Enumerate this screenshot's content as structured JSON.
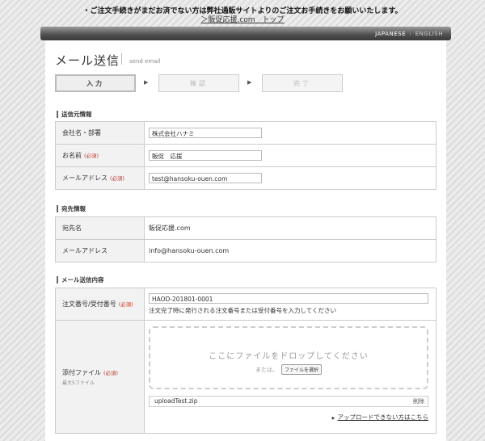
{
  "notice": {
    "text": "・ご注文手続きがまだお済でない方は弊社通販サイトよりのご注文お手続きをお願いいたします。",
    "top_link": "＞販促応援.com　トップ"
  },
  "lang": {
    "japanese": "JAPANESE",
    "separator": "|",
    "english": "ENGLISH"
  },
  "page": {
    "title": "メール送信",
    "subtitle": "send email"
  },
  "steps": [
    {
      "label": "入力"
    },
    {
      "label": "確認"
    },
    {
      "label": "完了"
    }
  ],
  "sender": {
    "title": "送信元情報",
    "rows": [
      {
        "label": "会社名・部署",
        "required": "",
        "value": "株式会社ハナミ"
      },
      {
        "label": "お名前",
        "required": "(必須)",
        "value": "販促　応援"
      },
      {
        "label": "メールアドレス",
        "required": "(必須)",
        "value": "test@hansoku-ouen.com"
      }
    ]
  },
  "recipient": {
    "title": "宛先情報",
    "rows": [
      {
        "label": "宛先名",
        "value": "販促応援.com"
      },
      {
        "label": "メールアドレス",
        "value": "info@hansoku-ouen.com"
      }
    ]
  },
  "mail": {
    "title": "メール送信内容",
    "order": {
      "label": "注文番号/受付番号",
      "required": "(必須)",
      "value": "HAOD-201801-0001",
      "note": "注文完了時に発行される注文番号または受付番号を入力してください"
    },
    "attach": {
      "label": "添付ファイル",
      "required": "(必須)",
      "hint": "最大5ファイル",
      "drop_text": "ここにファイルをドロップしてください",
      "or_text": "または、",
      "select_button": "ファイルを選択",
      "file_name": "uploadTest.zip",
      "delete_label": "削除",
      "upload_link": "アップロードできない方はこちら"
    }
  }
}
